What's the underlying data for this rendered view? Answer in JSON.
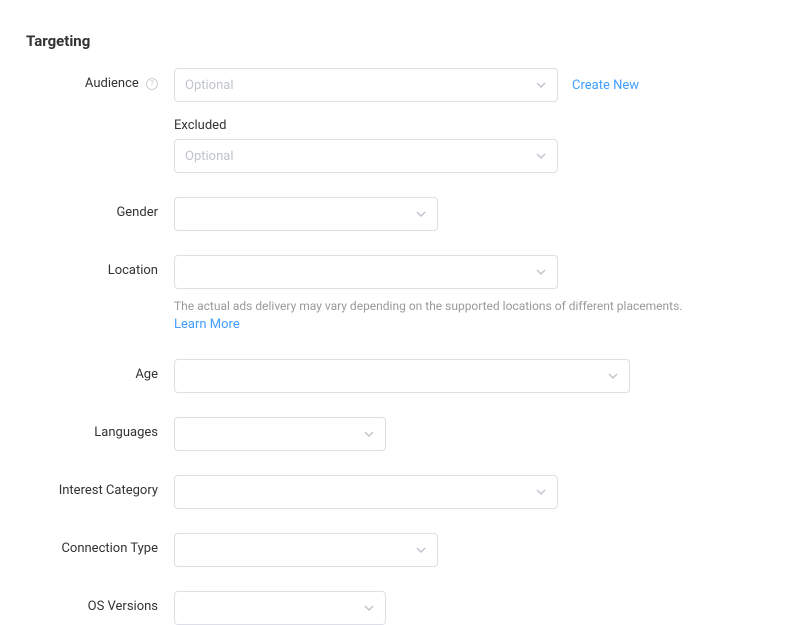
{
  "section": {
    "title": "Targeting"
  },
  "form": {
    "audience": {
      "label": "Audience",
      "placeholder": "Optional",
      "create_new": "Create New",
      "excluded_label": "Excluded",
      "excluded_placeholder": "Optional"
    },
    "gender": {
      "label": "Gender"
    },
    "location": {
      "label": "Location",
      "hint": "The actual ads delivery may vary depending on the supported locations of different placements.",
      "learn_more": "Learn More"
    },
    "age": {
      "label": "Age"
    },
    "languages": {
      "label": "Languages"
    },
    "interest_category": {
      "label": "Interest Category"
    },
    "connection_type": {
      "label": "Connection Type"
    },
    "os_versions": {
      "label": "OS Versions"
    }
  }
}
